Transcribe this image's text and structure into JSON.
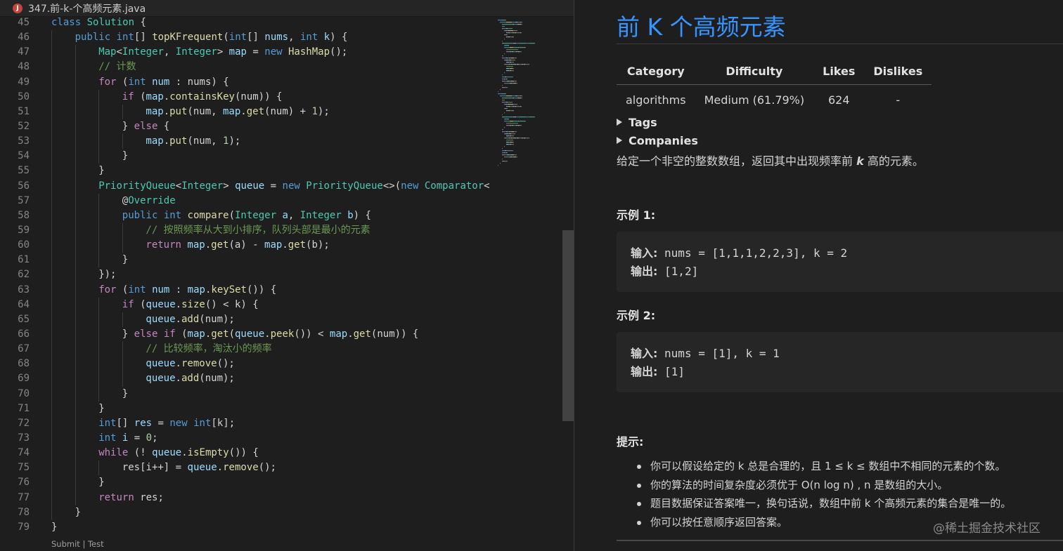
{
  "tab": {
    "icon_letter": "J",
    "filename": "347.前-k-个高频元素.java"
  },
  "code": {
    "lines": [
      {
        "n": "45",
        "i": 0,
        "t": [
          [
            "kw",
            "class"
          ],
          [
            "pl",
            " "
          ],
          [
            "ty",
            "Solution"
          ],
          [
            "pl",
            " {"
          ]
        ]
      },
      {
        "n": "46",
        "i": 1,
        "t": [
          [
            "kw",
            "public"
          ],
          [
            "pl",
            " "
          ],
          [
            "kw",
            "int"
          ],
          [
            "pl",
            "[] "
          ],
          [
            "fn",
            "topKFrequent"
          ],
          [
            "pl",
            "("
          ],
          [
            "kw",
            "int"
          ],
          [
            "pl",
            "[] "
          ],
          [
            "var",
            "nums"
          ],
          [
            "pl",
            ", "
          ],
          [
            "kw",
            "int"
          ],
          [
            "pl",
            " "
          ],
          [
            "var",
            "k"
          ],
          [
            "pl",
            ") {"
          ]
        ]
      },
      {
        "n": "47",
        "i": 2,
        "t": [
          [
            "ty",
            "Map"
          ],
          [
            "pl",
            "<"
          ],
          [
            "ty",
            "Integer"
          ],
          [
            "pl",
            ", "
          ],
          [
            "ty",
            "Integer"
          ],
          [
            "pl",
            "> "
          ],
          [
            "var",
            "map"
          ],
          [
            "pl",
            " = "
          ],
          [
            "kw",
            "new"
          ],
          [
            "pl",
            " "
          ],
          [
            "fn",
            "HashMap"
          ],
          [
            "pl",
            "();"
          ]
        ]
      },
      {
        "n": "48",
        "i": 2,
        "t": [
          [
            "cm",
            "// 计数"
          ]
        ]
      },
      {
        "n": "49",
        "i": 2,
        "t": [
          [
            "ctl",
            "for"
          ],
          [
            "pl",
            " ("
          ],
          [
            "kw",
            "int"
          ],
          [
            "pl",
            " "
          ],
          [
            "var",
            "num"
          ],
          [
            "pl",
            " : "
          ],
          [
            "pl",
            "nums) {"
          ]
        ]
      },
      {
        "n": "50",
        "i": 3,
        "t": [
          [
            "ctl",
            "if"
          ],
          [
            "pl",
            " ("
          ],
          [
            "var",
            "map"
          ],
          [
            "pl",
            "."
          ],
          [
            "fn",
            "containsKey"
          ],
          [
            "pl",
            "(num)) {"
          ]
        ]
      },
      {
        "n": "51",
        "i": 4,
        "t": [
          [
            "var",
            "map"
          ],
          [
            "pl",
            "."
          ],
          [
            "fn",
            "put"
          ],
          [
            "pl",
            "(num, "
          ],
          [
            "var",
            "map"
          ],
          [
            "pl",
            "."
          ],
          [
            "fn",
            "get"
          ],
          [
            "pl",
            "(num) + "
          ],
          [
            "num",
            "1"
          ],
          [
            "pl",
            ");"
          ]
        ]
      },
      {
        "n": "52",
        "i": 3,
        "t": [
          [
            "pl",
            "} "
          ],
          [
            "ctl",
            "else"
          ],
          [
            "pl",
            " {"
          ]
        ]
      },
      {
        "n": "53",
        "i": 4,
        "t": [
          [
            "var",
            "map"
          ],
          [
            "pl",
            "."
          ],
          [
            "fn",
            "put"
          ],
          [
            "pl",
            "(num, "
          ],
          [
            "num",
            "1"
          ],
          [
            "pl",
            ");"
          ]
        ]
      },
      {
        "n": "54",
        "i": 3,
        "t": [
          [
            "pl",
            "}"
          ]
        ]
      },
      {
        "n": "55",
        "i": 2,
        "t": [
          [
            "pl",
            "}"
          ]
        ]
      },
      {
        "n": "56",
        "i": 2,
        "t": [
          [
            "ty",
            "PriorityQueue"
          ],
          [
            "pl",
            "<"
          ],
          [
            "ty",
            "Integer"
          ],
          [
            "pl",
            "> "
          ],
          [
            "var",
            "queue"
          ],
          [
            "pl",
            " = "
          ],
          [
            "kw",
            "new"
          ],
          [
            "pl",
            " "
          ],
          [
            "ty",
            "PriorityQueue"
          ],
          [
            "pl",
            "<>("
          ],
          [
            "kw",
            "new"
          ],
          [
            "pl",
            " "
          ],
          [
            "ty",
            "Comparator"
          ],
          [
            "pl",
            "<"
          ]
        ]
      },
      {
        "n": "57",
        "i": 3,
        "t": [
          [
            "pl",
            "@"
          ],
          [
            "ty",
            "Override"
          ]
        ]
      },
      {
        "n": "58",
        "i": 3,
        "t": [
          [
            "kw",
            "public"
          ],
          [
            "pl",
            " "
          ],
          [
            "kw",
            "int"
          ],
          [
            "pl",
            " "
          ],
          [
            "fn",
            "compare"
          ],
          [
            "pl",
            "("
          ],
          [
            "ty",
            "Integer"
          ],
          [
            "pl",
            " "
          ],
          [
            "var",
            "a"
          ],
          [
            "pl",
            ", "
          ],
          [
            "ty",
            "Integer"
          ],
          [
            "pl",
            " "
          ],
          [
            "var",
            "b"
          ],
          [
            "pl",
            ") {"
          ]
        ]
      },
      {
        "n": "59",
        "i": 4,
        "t": [
          [
            "cm",
            "// 按照频率从大到小排序，队列头部是最小的元素"
          ]
        ]
      },
      {
        "n": "60",
        "i": 4,
        "t": [
          [
            "ctl",
            "return"
          ],
          [
            "pl",
            " "
          ],
          [
            "var",
            "map"
          ],
          [
            "pl",
            "."
          ],
          [
            "fn",
            "get"
          ],
          [
            "pl",
            "(a) - "
          ],
          [
            "var",
            "map"
          ],
          [
            "pl",
            "."
          ],
          [
            "fn",
            "get"
          ],
          [
            "pl",
            "(b);"
          ]
        ]
      },
      {
        "n": "61",
        "i": 3,
        "t": [
          [
            "pl",
            "}"
          ]
        ]
      },
      {
        "n": "62",
        "i": 2,
        "t": [
          [
            "pl",
            "});"
          ]
        ]
      },
      {
        "n": "63",
        "i": 2,
        "t": [
          [
            "ctl",
            "for"
          ],
          [
            "pl",
            " ("
          ],
          [
            "kw",
            "int"
          ],
          [
            "pl",
            " "
          ],
          [
            "var",
            "num"
          ],
          [
            "pl",
            " : "
          ],
          [
            "var",
            "map"
          ],
          [
            "pl",
            "."
          ],
          [
            "fn",
            "keySet"
          ],
          [
            "pl",
            "()) {"
          ]
        ]
      },
      {
        "n": "64",
        "i": 3,
        "t": [
          [
            "ctl",
            "if"
          ],
          [
            "pl",
            " ("
          ],
          [
            "var",
            "queue"
          ],
          [
            "pl",
            "."
          ],
          [
            "fn",
            "size"
          ],
          [
            "pl",
            "() < k) {"
          ]
        ]
      },
      {
        "n": "65",
        "i": 4,
        "t": [
          [
            "var",
            "queue"
          ],
          [
            "pl",
            "."
          ],
          [
            "fn",
            "add"
          ],
          [
            "pl",
            "(num);"
          ]
        ]
      },
      {
        "n": "66",
        "i": 3,
        "t": [
          [
            "pl",
            "} "
          ],
          [
            "ctl",
            "else"
          ],
          [
            "pl",
            " "
          ],
          [
            "ctl",
            "if"
          ],
          [
            "pl",
            " ("
          ],
          [
            "var",
            "map"
          ],
          [
            "pl",
            "."
          ],
          [
            "fn",
            "get"
          ],
          [
            "pl",
            "("
          ],
          [
            "var",
            "queue"
          ],
          [
            "pl",
            "."
          ],
          [
            "fn",
            "peek"
          ],
          [
            "pl",
            "()) < "
          ],
          [
            "var",
            "map"
          ],
          [
            "pl",
            "."
          ],
          [
            "fn",
            "get"
          ],
          [
            "pl",
            "(num)) {"
          ]
        ]
      },
      {
        "n": "67",
        "i": 4,
        "t": [
          [
            "cm",
            "// 比较频率，淘汰小的频率"
          ]
        ]
      },
      {
        "n": "68",
        "i": 4,
        "t": [
          [
            "var",
            "queue"
          ],
          [
            "pl",
            "."
          ],
          [
            "fn",
            "remove"
          ],
          [
            "pl",
            "();"
          ]
        ]
      },
      {
        "n": "69",
        "i": 4,
        "t": [
          [
            "var",
            "queue"
          ],
          [
            "pl",
            "."
          ],
          [
            "fn",
            "add"
          ],
          [
            "pl",
            "(num);"
          ]
        ]
      },
      {
        "n": "70",
        "i": 3,
        "t": [
          [
            "pl",
            "}"
          ]
        ]
      },
      {
        "n": "71",
        "i": 2,
        "t": [
          [
            "pl",
            "}"
          ]
        ]
      },
      {
        "n": "72",
        "i": 2,
        "t": [
          [
            "kw",
            "int"
          ],
          [
            "pl",
            "[] "
          ],
          [
            "var",
            "res"
          ],
          [
            "pl",
            " = "
          ],
          [
            "kw",
            "new"
          ],
          [
            "pl",
            " "
          ],
          [
            "kw",
            "int"
          ],
          [
            "pl",
            "[k];"
          ]
        ]
      },
      {
        "n": "73",
        "i": 2,
        "t": [
          [
            "kw",
            "int"
          ],
          [
            "pl",
            " "
          ],
          [
            "var",
            "i"
          ],
          [
            "pl",
            " = "
          ],
          [
            "num",
            "0"
          ],
          [
            "pl",
            ";"
          ]
        ]
      },
      {
        "n": "74",
        "i": 2,
        "t": [
          [
            "ctl",
            "while"
          ],
          [
            "pl",
            " (! "
          ],
          [
            "var",
            "queue"
          ],
          [
            "pl",
            "."
          ],
          [
            "fn",
            "isEmpty"
          ],
          [
            "pl",
            "()) {"
          ]
        ]
      },
      {
        "n": "75",
        "i": 3,
        "t": [
          [
            "pl",
            "res[i++] = "
          ],
          [
            "var",
            "queue"
          ],
          [
            "pl",
            "."
          ],
          [
            "fn",
            "remove"
          ],
          [
            "pl",
            "();"
          ]
        ]
      },
      {
        "n": "76",
        "i": 2,
        "t": [
          [
            "pl",
            "}"
          ]
        ]
      },
      {
        "n": "77",
        "i": 2,
        "t": [
          [
            "ctl",
            "return"
          ],
          [
            "pl",
            " res;"
          ]
        ]
      },
      {
        "n": "78",
        "i": 1,
        "t": [
          [
            "pl",
            "}"
          ]
        ]
      },
      {
        "n": "79",
        "i": 0,
        "t": [
          [
            "pl",
            "}"
          ]
        ]
      }
    ]
  },
  "codelens": {
    "submit": "Submit",
    "sep": " | ",
    "test": "Test"
  },
  "preview": {
    "title": "前 K 个高频元素",
    "table": {
      "headers": [
        "Category",
        "Difficulty",
        "Likes",
        "Dislikes"
      ],
      "row": [
        "algorithms",
        "Medium (61.79%)",
        "624",
        "-"
      ]
    },
    "tags_label": "Tags",
    "companies_label": "Companies",
    "description_pre": "给定一个非空的整数数组，返回其中出现频率前 ",
    "description_k": "k",
    "description_post": " 高的元素。",
    "example1": {
      "heading": "示例 1:",
      "in_label": "输入:",
      "in_value": " nums = [1,1,1,2,2,3], k = 2",
      "out_label": "输出:",
      "out_value": " [1,2]"
    },
    "example2": {
      "heading": "示例 2:",
      "in_label": "输入:",
      "in_value": " nums = [1], k = 1",
      "out_label": "输出:",
      "out_value": " [1]"
    },
    "hints_heading": "提示:",
    "hints": [
      "你可以假设给定的 k 总是合理的，且 1 ≤ k ≤ 数组中不相同的元素的个数。",
      "你的算法的时间复杂度必须优于 O(n log n) , n 是数组的大小。",
      "题目数据保证答案唯一，换句话说，数组中前 k 个高频元素的集合是唯一的。",
      "你可以按任意顺序返回答案。"
    ],
    "watermark": "@稀土掘金技术社区"
  },
  "colors": {
    "accent": "#3794ff",
    "editor_bg": "#1e1e1e",
    "keyword": "#569cd6",
    "type": "#4ec9b0",
    "function": "#dcdcaa",
    "comment": "#6a9955"
  }
}
